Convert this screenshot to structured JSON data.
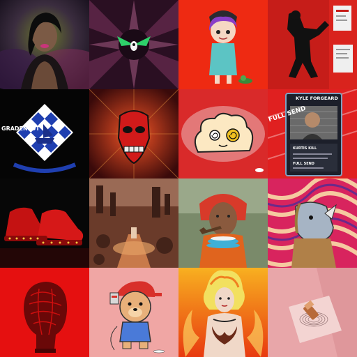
{
  "gallery": {
    "tiles": [
      {
        "text": ""
      },
      {
        "text": ""
      },
      {
        "text": ""
      },
      {
        "text": ""
      },
      {
        "text": "GRADENLOT"
      },
      {
        "text": ""
      },
      {
        "text": ""
      },
      {
        "id_name": "KYLE FORGEARD",
        "id_field1": "KURTIS KILL",
        "id_field2": "FULL SEND",
        "banner": "FULL SEND"
      },
      {
        "text": ""
      },
      {
        "text": ""
      },
      {
        "text": ""
      },
      {
        "text": ""
      },
      {
        "text": ""
      },
      {
        "text": ""
      },
      {
        "text": ""
      },
      {
        "text": ""
      }
    ]
  },
  "colors": {
    "red": "#e01010",
    "pink_bg": "#e8a6a9",
    "dark": "#0a0a0a"
  }
}
